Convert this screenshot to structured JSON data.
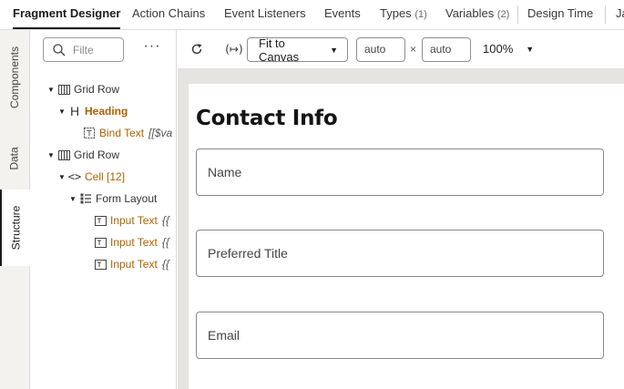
{
  "top_tabs": {
    "items": [
      {
        "label": "Fragment Designer",
        "count": "",
        "active": true
      },
      {
        "label": "Action Chains",
        "count": ""
      },
      {
        "label": "Event Listeners",
        "count": ""
      },
      {
        "label": "Events",
        "count": ""
      },
      {
        "label": "Types",
        "count": "(1)"
      },
      {
        "label": "Variables",
        "count": "(2)"
      },
      {
        "label": "Design Time",
        "count": ""
      },
      {
        "label": "Ja",
        "count": ""
      }
    ]
  },
  "side_tabs": [
    "Components",
    "Data",
    "Structure"
  ],
  "structure_panel": {
    "filter_placeholder": "Filte",
    "more_label": "···",
    "tree": [
      {
        "label": "Grid Row",
        "expr": "",
        "icon": "grid-row-icon"
      },
      {
        "label": "Heading",
        "expr": "",
        "icon": "heading-icon"
      },
      {
        "label": "Bind Text",
        "expr": "[[$va",
        "icon": "bind-text-icon"
      },
      {
        "label": "Grid Row",
        "expr": "",
        "icon": "grid-row-icon"
      },
      {
        "label": "Cell [12]",
        "expr": "",
        "icon": "cell-code-icon"
      },
      {
        "label": "Form Layout",
        "expr": "",
        "icon": "form-layout-icon"
      },
      {
        "label": "Input Text",
        "expr": "{{",
        "icon": "input-text-icon"
      },
      {
        "label": "Input Text",
        "expr": "{{",
        "icon": "input-text-icon"
      },
      {
        "label": "Input Text",
        "expr": "{{",
        "icon": "input-text-icon"
      }
    ]
  },
  "toolbar": {
    "refresh_icon": "refresh-icon",
    "fit_icon": "fit-width-icon",
    "fit_select": "Fit to Canvas",
    "width": "auto",
    "times": "×",
    "height": "auto",
    "zoom": "100%"
  },
  "canvas": {
    "heading": "Contact Info",
    "fields": [
      "Name",
      "Preferred Title",
      "Email"
    ]
  },
  "colors": {
    "accent_orange": "#b06200",
    "canvas_bg": "#e6e4e1",
    "side_bg": "#f4f2ef"
  }
}
